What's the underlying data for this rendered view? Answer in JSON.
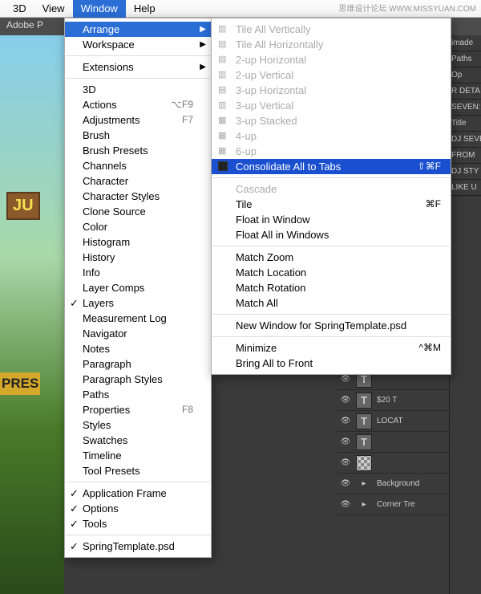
{
  "watermark": "思维设计论坛 WWW.MISSYUAN.COM",
  "menubar": {
    "items": [
      "3D",
      "View",
      "Window",
      "Help"
    ],
    "active_index": 2
  },
  "app": {
    "title": "Adobe P"
  },
  "canvas": {
    "sign1": "JU",
    "sign2": "PRES"
  },
  "window_menu": {
    "groups": [
      [
        {
          "label": "Arrange",
          "submenu": true,
          "highlight": true
        },
        {
          "label": "Workspace",
          "submenu": true
        }
      ],
      [
        {
          "label": "Extensions",
          "submenu": true
        }
      ],
      [
        {
          "label": "3D"
        },
        {
          "label": "Actions",
          "shortcut": "⌥F9"
        },
        {
          "label": "Adjustments",
          "shortcut": "F7"
        },
        {
          "label": "Brush"
        },
        {
          "label": "Brush Presets"
        },
        {
          "label": "Channels"
        },
        {
          "label": "Character"
        },
        {
          "label": "Character Styles"
        },
        {
          "label": "Clone Source"
        },
        {
          "label": "Color"
        },
        {
          "label": "Histogram"
        },
        {
          "label": "History"
        },
        {
          "label": "Info"
        },
        {
          "label": "Layer Comps"
        },
        {
          "label": "Layers",
          "checked": true
        },
        {
          "label": "Measurement Log"
        },
        {
          "label": "Navigator"
        },
        {
          "label": "Notes"
        },
        {
          "label": "Paragraph"
        },
        {
          "label": "Paragraph Styles"
        },
        {
          "label": "Paths"
        },
        {
          "label": "Properties",
          "shortcut": "F8"
        },
        {
          "label": "Styles"
        },
        {
          "label": "Swatches"
        },
        {
          "label": "Timeline"
        },
        {
          "label": "Tool Presets"
        }
      ],
      [
        {
          "label": "Application Frame",
          "checked": true
        },
        {
          "label": "Options",
          "checked": true
        },
        {
          "label": "Tools",
          "checked": true
        }
      ],
      [
        {
          "label": "SpringTemplate.psd",
          "checked": true
        }
      ]
    ]
  },
  "arrange_menu": {
    "groups": [
      [
        {
          "label": "Tile All Vertically",
          "icon": "▥",
          "disabled": true
        },
        {
          "label": "Tile All Horizontally",
          "icon": "▤",
          "disabled": true
        },
        {
          "label": "2-up Horizontal",
          "icon": "▤",
          "disabled": true
        },
        {
          "label": "2-up Vertical",
          "icon": "▥",
          "disabled": true
        },
        {
          "label": "3-up Horizontal",
          "icon": "▤",
          "disabled": true
        },
        {
          "label": "3-up Vertical",
          "icon": "▥",
          "disabled": true
        },
        {
          "label": "3-up Stacked",
          "icon": "▦",
          "disabled": true
        },
        {
          "label": "4-up",
          "icon": "▦",
          "disabled": true
        },
        {
          "label": "6-up",
          "icon": "▦",
          "disabled": true
        },
        {
          "label": "Consolidate All to Tabs",
          "darkicon": true,
          "selected": true,
          "shortcut": "⇧⌘F"
        }
      ],
      [
        {
          "label": "Cascade",
          "disabled": true
        },
        {
          "label": "Tile",
          "shortcut": "⌘F"
        },
        {
          "label": "Float in Window"
        },
        {
          "label": "Float All in Windows"
        }
      ],
      [
        {
          "label": "Match Zoom"
        },
        {
          "label": "Match Location"
        },
        {
          "label": "Match Rotation"
        },
        {
          "label": "Match All"
        }
      ],
      [
        {
          "label": "New Window for SpringTemplate.psd"
        }
      ],
      [
        {
          "label": "Minimize",
          "shortcut": "^⌘M"
        },
        {
          "label": "Bring All to Front"
        }
      ]
    ]
  },
  "right_panel": {
    "tabs": [
      "imade",
      "Paths",
      "Op",
      "R DETA",
      "SEVEN:",
      "Title",
      "DJ SEVE",
      "FROM",
      "DJ STY",
      "LIKE U"
    ]
  },
  "layers": {
    "rows": [
      {
        "type": "T",
        "name": ""
      },
      {
        "type": "T",
        "name": "$20 T"
      },
      {
        "type": "T",
        "name": "LOCAT"
      },
      {
        "type": "T",
        "name": ""
      },
      {
        "type": "img",
        "name": ""
      },
      {
        "type": "group",
        "name": "Background"
      },
      {
        "type": "group",
        "name": "Corner Tre"
      }
    ]
  }
}
